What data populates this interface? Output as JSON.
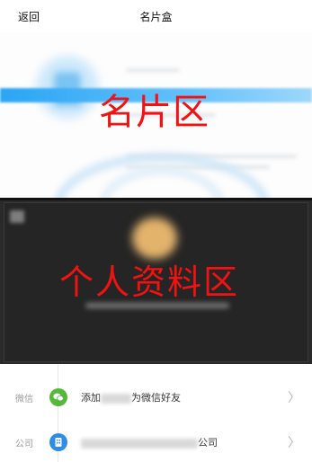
{
  "nav": {
    "back_label": "返回",
    "title": "名片盒"
  },
  "card_area": {
    "overlay_label": "名片区",
    "accent_color": "#2aa5f5",
    "label_color": "#f21212"
  },
  "profile_area": {
    "overlay_label": "个人资料区",
    "background_color": "#2a2a2a",
    "label_color": "#f21212"
  },
  "info_rows": [
    {
      "label": "微信",
      "icon": "wechat-icon",
      "text_prefix": "添加",
      "text_suffix": "为微信好友",
      "chevron": "〉"
    },
    {
      "label": "公司",
      "icon": "company-icon",
      "text_prefix": "",
      "text_suffix": "公司",
      "chevron": "〉"
    }
  ]
}
